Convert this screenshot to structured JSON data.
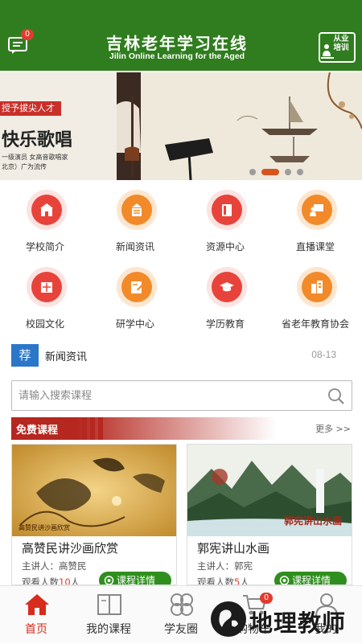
{
  "header": {
    "title": "吉林老年学习在线",
    "subtitle": "Jilin Online Learning for the Aged",
    "message_badge": "0",
    "training_label": "从业培训"
  },
  "banner": {
    "tag": "授予拔尖人才",
    "headline": "快乐歌唱",
    "line1": "一级演员 女高音歌唱家",
    "line2": "北京）广为流传",
    "active_slide": 2,
    "slide_count": 4
  },
  "menu": [
    {
      "label": "学校简介",
      "icon": "school-icon",
      "color": "red"
    },
    {
      "label": "新闻资讯",
      "icon": "news-icon",
      "color": "orange"
    },
    {
      "label": "资源中心",
      "icon": "book-icon",
      "color": "red"
    },
    {
      "label": "直播课堂",
      "icon": "live-class-icon",
      "color": "orange"
    },
    {
      "label": "校园文化",
      "icon": "culture-icon",
      "color": "red"
    },
    {
      "label": "研学中心",
      "icon": "study-icon",
      "color": "orange"
    },
    {
      "label": "学历教育",
      "icon": "graduation-cap-icon",
      "color": "red"
    },
    {
      "label": "省老年教育协会",
      "icon": "building-icon",
      "color": "orange"
    }
  ],
  "news": {
    "tag": "荐",
    "title": "新闻资讯",
    "date": "08-13"
  },
  "search": {
    "placeholder": "请输入搜索课程"
  },
  "free_courses": {
    "title": "免费课程",
    "more": "更多 >>",
    "courses": [
      {
        "title": "高赞民讲沙画欣赏",
        "lecturer_label": "主讲人：",
        "lecturer": "高赞民",
        "views_label": "观看人数",
        "views": "10",
        "views_unit": "人",
        "button": "课程详情",
        "image_caption": "高赞民讲沙画欣赏"
      },
      {
        "title": "郭宪讲山水画",
        "lecturer_label": "主讲人：",
        "lecturer": "郭宪",
        "views_label": "观看人数",
        "views": "5",
        "views_unit": "人",
        "button": "课程详情",
        "image_caption": "郭宪讲山水画"
      }
    ]
  },
  "tabbar": {
    "items": [
      {
        "label": "首页",
        "icon": "home-icon",
        "active": true
      },
      {
        "label": "我的课程",
        "icon": "open-book-icon",
        "active": false
      },
      {
        "label": "学友圈",
        "icon": "circles-icon",
        "active": false
      },
      {
        "label": "购物车",
        "icon": "cart-icon",
        "active": false,
        "badge": "0"
      },
      {
        "label": "我的",
        "icon": "user-icon",
        "active": false
      }
    ]
  },
  "watermark": {
    "text": "地理教师"
  },
  "colors": {
    "brand_green": "#2f7d1e",
    "accent_red": "#e8433a",
    "accent_orange": "#f28a2a",
    "news_blue": "#2a76c9",
    "free_red": "#b5271f"
  }
}
